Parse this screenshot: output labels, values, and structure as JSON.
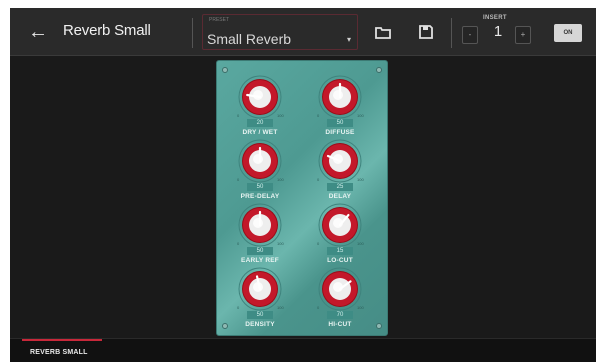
{
  "header": {
    "back_icon": "arrow-left-icon",
    "title": "Reverb Small",
    "preset": {
      "sub_label": "PRESET",
      "value": "Small Reverb",
      "arrow": "▾"
    },
    "folder_icon": "folder-icon",
    "save_icon": "save-icon",
    "insert": {
      "label": "INSERT",
      "value": "1",
      "minus": "-",
      "plus": "+"
    },
    "on_label": "ON"
  },
  "plugin": {
    "knobs": [
      {
        "label": "DRY / WET",
        "value": "20",
        "level": 0.2
      },
      {
        "label": "DIFFUSE",
        "value": "50",
        "level": 0.5
      },
      {
        "label": "PRE-DELAY",
        "value": "50",
        "level": 0.5
      },
      {
        "label": "DELAY",
        "value": "25",
        "level": 0.25
      },
      {
        "label": "EARLY REF",
        "value": "50",
        "level": 0.5
      },
      {
        "label": "LO-CUT",
        "value": "15",
        "level": 0.65
      },
      {
        "label": "DENSITY",
        "value": "50",
        "level": 0.45
      },
      {
        "label": "HI-CUT",
        "value": "70",
        "level": 0.7
      }
    ],
    "tick_min": "0",
    "tick_max": "100"
  },
  "bottom": {
    "tab_label": "REVERB SMALL"
  },
  "colors": {
    "accent": "#c8283a",
    "panel": "#4e9a92",
    "knob_red": "#b3121e"
  }
}
